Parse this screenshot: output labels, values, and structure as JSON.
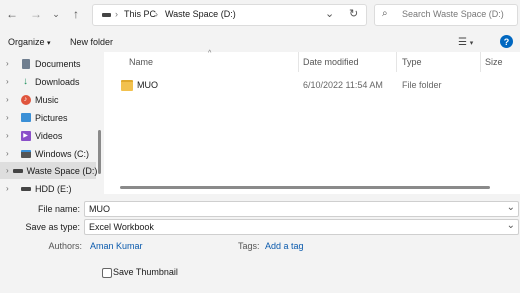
{
  "address": {
    "crumbs": [
      "This PC",
      "Waste Space (D:)"
    ],
    "search_placeholder": "Search Waste Space (D:)"
  },
  "toolbar": {
    "organize_label": "Organize",
    "new_folder_label": "New folder",
    "help_label": "?"
  },
  "sidebar": {
    "items": [
      {
        "label": "Documents"
      },
      {
        "label": "Downloads"
      },
      {
        "label": "Music"
      },
      {
        "label": "Pictures"
      },
      {
        "label": "Videos"
      },
      {
        "label": "Windows (C:)"
      },
      {
        "label": "Waste Space (D:)"
      },
      {
        "label": "HDD (E:)"
      }
    ]
  },
  "columns": {
    "name": "Name",
    "date": "Date modified",
    "type": "Type",
    "size": "Size"
  },
  "files": [
    {
      "name": "MUO",
      "date": "6/10/2022 11:54 AM",
      "type": "File folder"
    }
  ],
  "form": {
    "file_name_label": "File name:",
    "file_name_value": "MUO",
    "save_type_label": "Save as type:",
    "save_type_value": "Excel Workbook",
    "authors_label": "Authors:",
    "authors_value": "Aman Kumar",
    "tags_label": "Tags:",
    "tags_value": "Add a tag",
    "thumbnail_label": "Save Thumbnail"
  },
  "colors": {
    "accent": "#0067c0",
    "link": "#0a5aad",
    "folder": "#f2c14e"
  }
}
